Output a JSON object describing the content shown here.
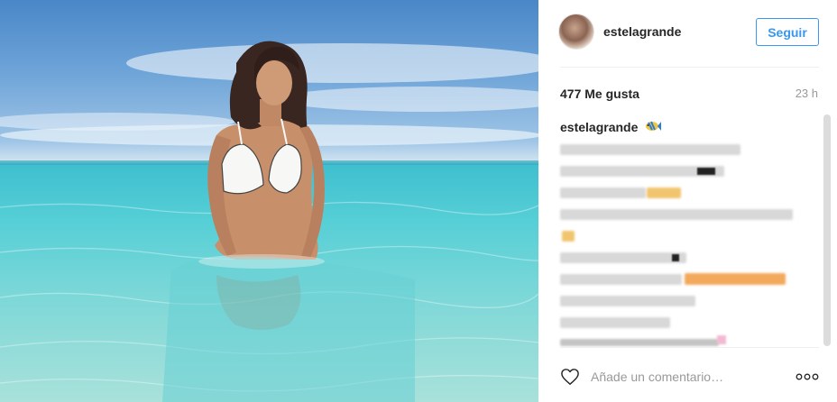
{
  "header": {
    "username": "estelagrande",
    "follow_label": "Seguir"
  },
  "meta": {
    "likes": "477 Me gusta",
    "time": "23 h"
  },
  "caption": {
    "username": "estelagrande"
  },
  "comment": {
    "placeholder": "Añade un comentario…"
  },
  "icons": {
    "heart": "heart-icon",
    "more": "more-options-icon",
    "fish": "tropical-fish-emoji"
  },
  "colors": {
    "follow": "#3897f0",
    "muted": "#999999",
    "text": "#262626"
  }
}
